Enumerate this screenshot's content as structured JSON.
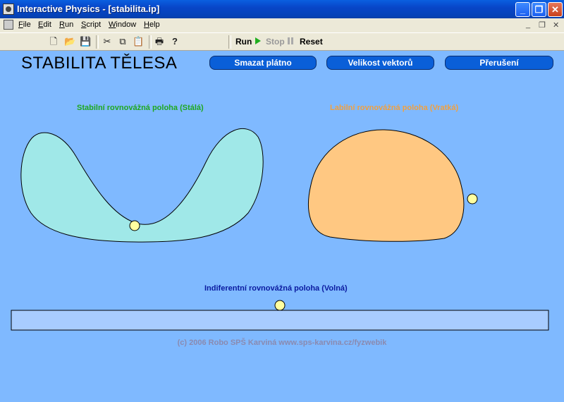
{
  "window": {
    "title": "Interactive Physics - [stabilita.ip]",
    "minimize": "_",
    "maximize": "❐",
    "close": "✕"
  },
  "menu": {
    "items": [
      {
        "label": "File",
        "key": "F",
        "rest": "ile"
      },
      {
        "label": "Edit",
        "key": "E",
        "rest": "dit"
      },
      {
        "label": "Run",
        "key": "R",
        "rest": "un"
      },
      {
        "label": "Script",
        "key": "S",
        "rest": "cript"
      },
      {
        "label": "Window",
        "key": "W",
        "rest": "indow"
      },
      {
        "label": "Help",
        "key": "H",
        "rest": "elp"
      }
    ],
    "doc_min": "_",
    "doc_restore": "❐",
    "doc_close": "✕"
  },
  "toolbar": {
    "new": "🗋",
    "open": "📂",
    "save": "💾",
    "cut": "✂",
    "copy": "⧉",
    "paste": "📋",
    "print": "🖶",
    "help": "?",
    "run_label": "Run",
    "stop_label": "Stop",
    "reset_label": "Reset"
  },
  "canvas": {
    "heading": "STABILITA TĚLESA",
    "buttons": {
      "clear": "Smazat plátno",
      "vectors": "Velikost vektorů",
      "pause": "Přerušení"
    },
    "labels": {
      "stable": "Stabilní rovnovážná poloha (Stálá)",
      "labile": "Labilní rovnovážná poloha (Vratká)",
      "indifferent": "Indiferentní rovnovážná poloha (Volná)"
    },
    "footer": "(c) 2006 Robo SPŠ Karviná  www.sps-karvina.cz/fyzwebik"
  },
  "colors": {
    "background": "#7fb9ff",
    "stable_label": "#1fa81f",
    "labile_label": "#f0a040",
    "indifferent_label": "#0a1aa0",
    "bowl_fill": "#a0e8e8",
    "dome_fill": "#ffc882",
    "ball_fill": "#ffffa0",
    "plane_fill": "#a8ccff",
    "button_fill": "#0a5fd8"
  }
}
